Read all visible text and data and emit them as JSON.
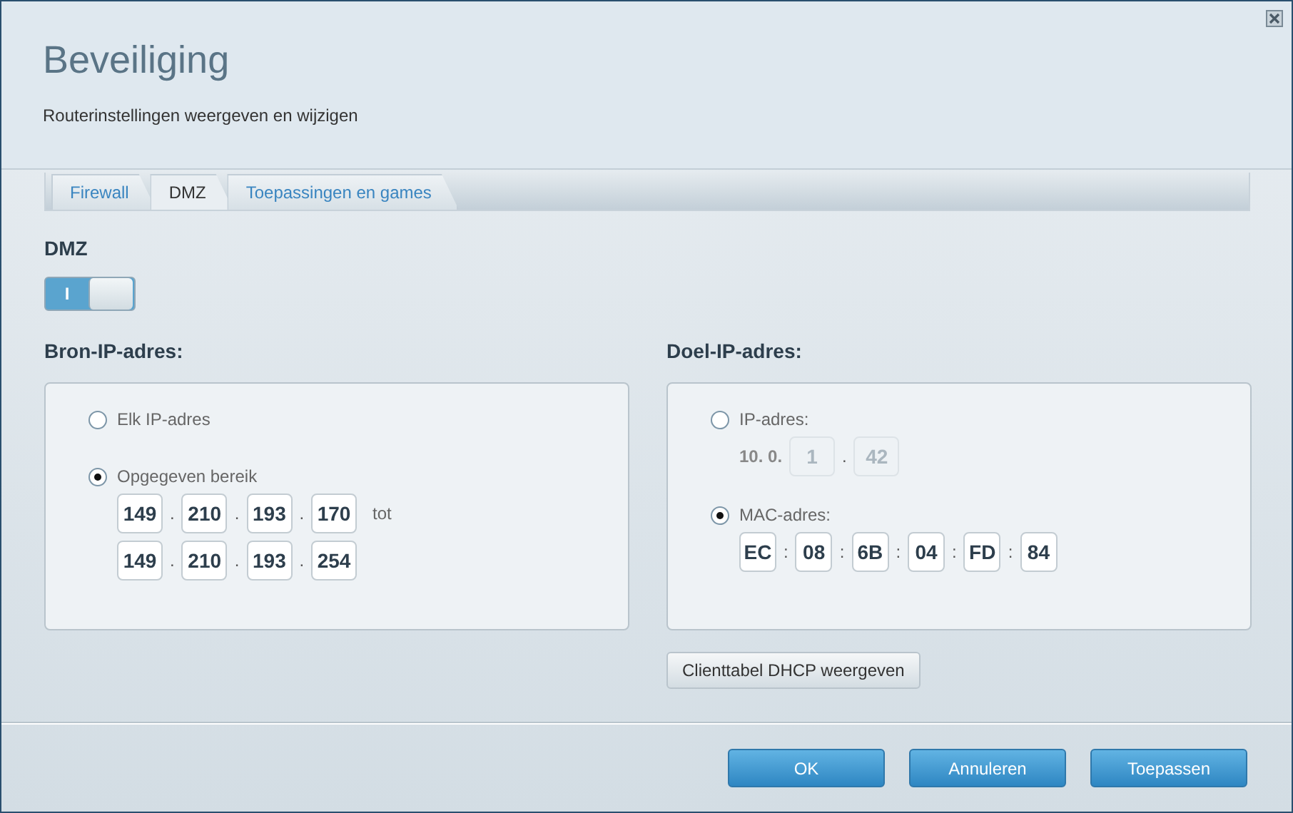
{
  "window": {
    "title": "Beveiliging",
    "subtitle": "Routerinstellingen weergeven en wijzigen"
  },
  "tabs": [
    {
      "label": "Firewall",
      "selected": false
    },
    {
      "label": "DMZ",
      "selected": true
    },
    {
      "label": "Toepassingen en games",
      "selected": false
    }
  ],
  "dmz": {
    "heading": "DMZ",
    "toggle": {
      "label": "I",
      "on": true
    }
  },
  "source": {
    "heading": "Bron-IP-adres:",
    "options": [
      {
        "label": "Elk IP-adres",
        "selected": false
      },
      {
        "label": "Opgegeven bereik",
        "selected": true,
        "range": {
          "from": [
            "149",
            "210",
            "193",
            "170"
          ],
          "from_separators": [
            ".",
            ".",
            "."
          ],
          "suffix": "tot",
          "to": [
            "149",
            "210",
            "193",
            "254"
          ],
          "to_separators": [
            ".",
            ".",
            "."
          ]
        }
      }
    ]
  },
  "destination": {
    "heading": "Doel-IP-adres:",
    "options": [
      {
        "kind": "ip",
        "label": "IP-adres:",
        "selected": false,
        "prefix": "10. 0.",
        "fields": [
          "1",
          "42"
        ],
        "separators": [
          "."
        ],
        "disabled": true
      },
      {
        "kind": "mac",
        "label": "MAC-adres:",
        "selected": true,
        "fields": [
          "EC",
          "08",
          "6B",
          "04",
          "FD",
          "84"
        ],
        "separators": [
          ":",
          ":",
          ":",
          ":",
          ":"
        ]
      }
    ],
    "dhcp_button": "Clienttabel DHCP weergeven"
  },
  "buttons": [
    "OK",
    "Annuleren",
    "Toepassen"
  ]
}
